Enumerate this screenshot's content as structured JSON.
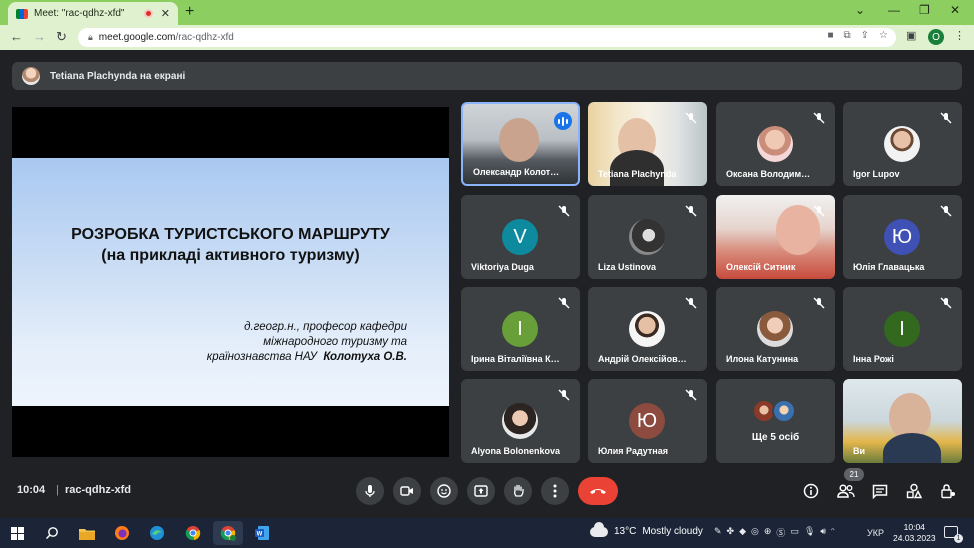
{
  "browser": {
    "tab_title": "Meet: \"rac-qdhz-xfd\"",
    "new_tab": "+",
    "url_host": "meet.google.com",
    "url_path": "/rac-qdhz-xfd",
    "profile_initial": "O"
  },
  "meet": {
    "presenting_banner": "Tetiana Plachynda на екрані",
    "slide": {
      "title_line1": "РОЗРОБКА ТУРИСТСЬКОГО МАРШРУТУ",
      "title_line2": "(на прикладі активного туризму)",
      "author_line1": "д.геогр.н., професор кафедри",
      "author_line2": "міжнародного туризму та",
      "author_line3": "країнознавства НАУ",
      "author_name": "Колотуха О.В."
    },
    "participants": [
      {
        "name": "Олександр Колот…",
        "type": "video"
      },
      {
        "name": "Tetiana Plachynda",
        "type": "video"
      },
      {
        "name": "Оксана Володим…",
        "type": "photo"
      },
      {
        "name": "Igor Lupov",
        "type": "photo"
      },
      {
        "name": "Viktoriya Duga",
        "type": "letter",
        "initial": "V",
        "color": "#0e8a9e"
      },
      {
        "name": "Liza Ustinova",
        "type": "photo"
      },
      {
        "name": "Олексій Ситник",
        "type": "video"
      },
      {
        "name": "Юлія Главацька",
        "type": "letter",
        "initial": "Ю",
        "color": "#3f51b5"
      },
      {
        "name": "Ірина Віталіївна К…",
        "type": "letter",
        "initial": "І",
        "color": "#689f38"
      },
      {
        "name": "Андрій Олексійов…",
        "type": "photo"
      },
      {
        "name": "Илона Катунина",
        "type": "photo"
      },
      {
        "name": "Інна Рожі",
        "type": "letter",
        "initial": "І",
        "color": "#33691e"
      },
      {
        "name": "Alyona Bolonenkova",
        "type": "photo"
      },
      {
        "name": "Юлия Радутная",
        "type": "letter",
        "initial": "Ю",
        "color": "#8d4a3e"
      },
      {
        "name": "Ще 5 осіб",
        "type": "more"
      },
      {
        "name": "Ви",
        "type": "video"
      }
    ],
    "clock": "10:04",
    "separator": "|",
    "meeting_code": "rac-qdhz-xfd",
    "participant_count": "21"
  },
  "taskbar": {
    "weather_temp": "13°C",
    "weather_desc": "Mostly cloudy",
    "language": "УКР",
    "time": "10:04",
    "date": "24.03.2023",
    "notification_count": "1"
  }
}
